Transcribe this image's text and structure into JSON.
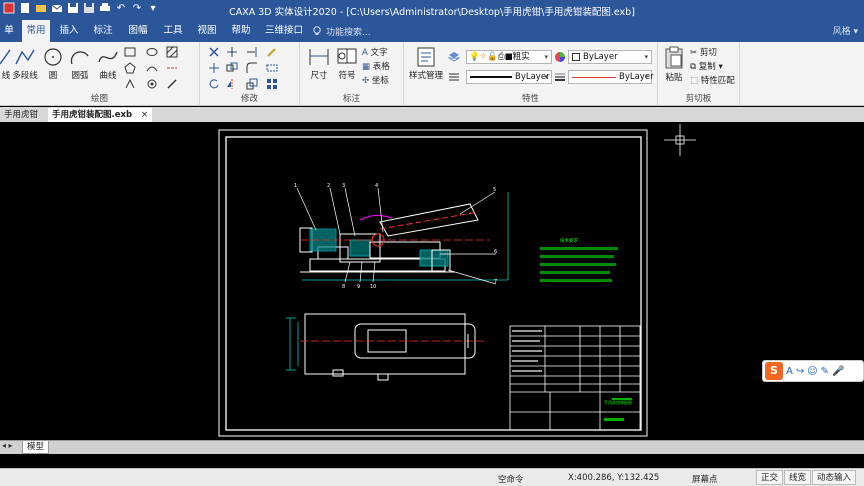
{
  "titlebar": {
    "title": "CAXA 3D 实体设计2020 - [C:\\Users\\Administrator\\Desktop\\手用虎钳\\手用虎钳装配图.exb]",
    "quick_access_icons": [
      "app-icon",
      "new-icon",
      "open-icon",
      "mail-icon",
      "save-icon",
      "saveas-icon",
      "print-icon",
      "undo-icon",
      "redo-icon",
      "customize-icon"
    ]
  },
  "menubar": {
    "tabs": [
      "单",
      "常用",
      "插入",
      "标注",
      "图幅",
      "工具",
      "视图",
      "帮助",
      "三维接口"
    ],
    "active_tab": "常用",
    "search_placeholder": "功能搜索...",
    "style_label": "风格"
  },
  "ribbon": {
    "draw": {
      "label": "绘图",
      "buttons": [
        "线",
        "多段线",
        "圆",
        "圆弧",
        "曲线"
      ]
    },
    "modify": {
      "label": "修改"
    },
    "annotate": {
      "label": "标注",
      "size_label": "尺寸",
      "symbol_label": "符号",
      "text_label": "文字",
      "table_label": "表格",
      "coord_label": "坐标"
    },
    "properties": {
      "label": "特性",
      "style_manage_label": "样式管理",
      "layer_name": "粗实",
      "color_value": "ByLayer",
      "linetype_value": "ByLayer",
      "linewidth_value": "ByLayer"
    },
    "clipboard": {
      "label": "剪切板",
      "paste_label": "粘贴",
      "cut_label": "剪切",
      "copy_label": "复制",
      "match_label": "特性匹配"
    }
  },
  "doctabs": {
    "tabs": [
      "手用虎钳",
      "手用虎钳装配图.exb"
    ],
    "active_index": 1,
    "close_symbol": "×"
  },
  "drawing": {
    "notes_title": "技术要求",
    "table_title": "手用虎钳装配图",
    "balloon_numbers": [
      "1",
      "2",
      "3",
      "4",
      "5",
      "6",
      "7",
      "8",
      "9",
      "10"
    ]
  },
  "modelbar": {
    "arrows": "◂ ▸",
    "tab_label": "模型"
  },
  "statusbar": {
    "command": "空命令",
    "coords": "X:400.286, Y:132.425",
    "snap_mode": "屏幕点",
    "ortho": "正交",
    "linewidth": "线宽",
    "dynamic_input": "动态输入"
  },
  "ime": {
    "logo": "S",
    "items": [
      "A",
      "↪",
      "☺",
      "✎",
      "🎤"
    ]
  },
  "colors": {
    "title_blue": "#2b579a",
    "drawing_white": "#ffffff",
    "drawing_green": "#00ff00",
    "drawing_cyan": "#00c8c8",
    "drawing_red": "#ff3030",
    "drawing_magenta": "#ff00ff"
  }
}
